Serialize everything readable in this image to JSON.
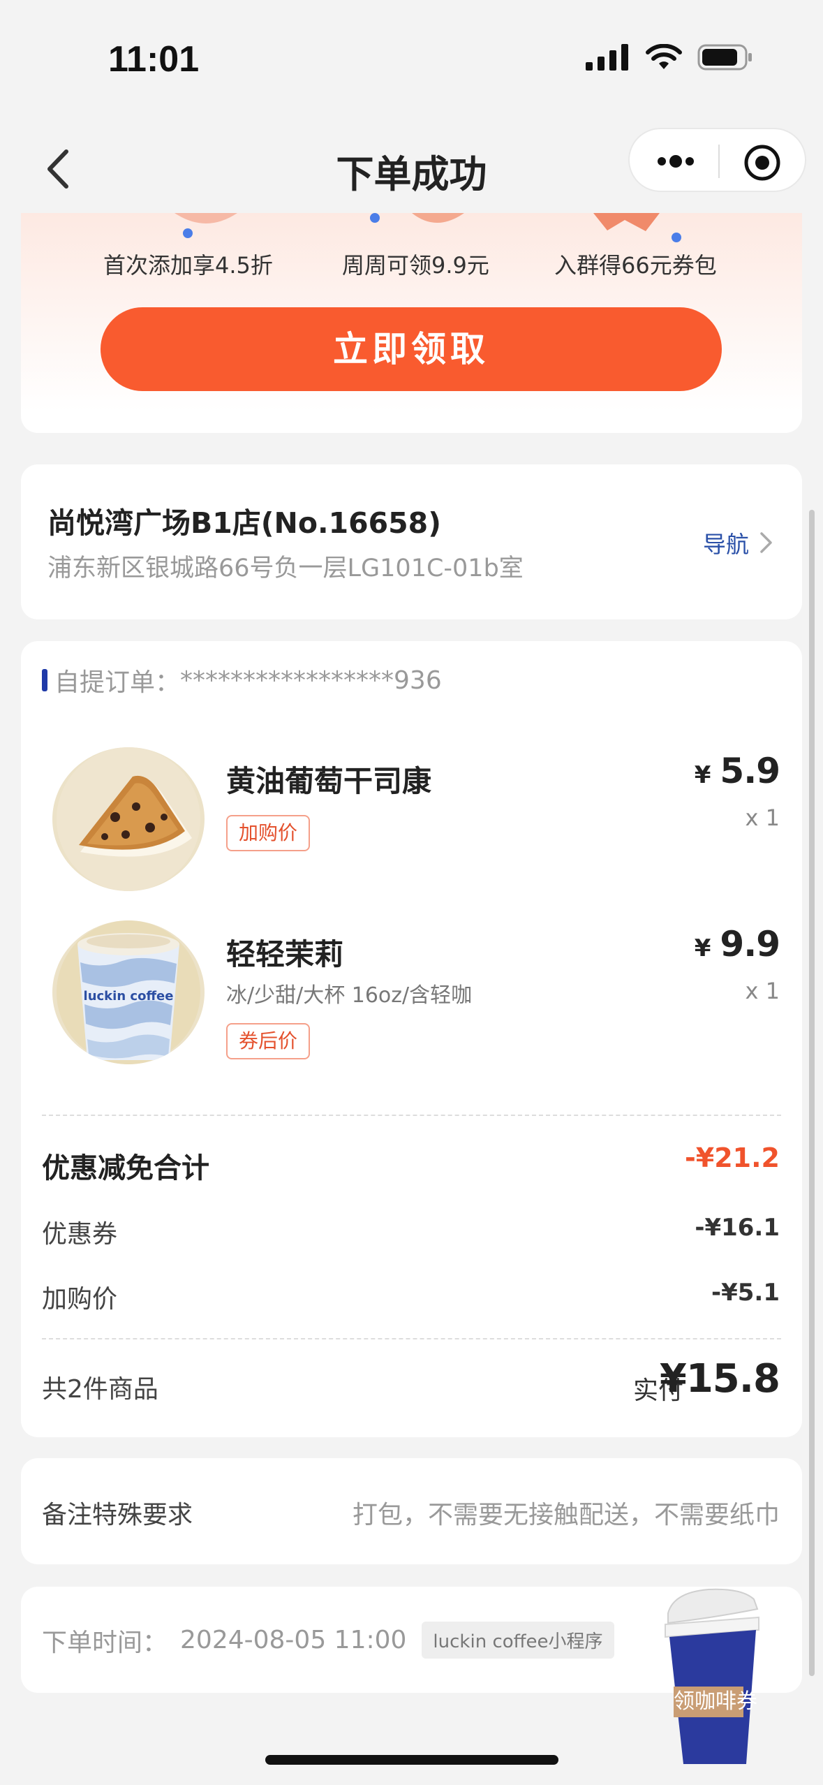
{
  "status_bar": {
    "time": "11:01"
  },
  "nav": {
    "title": "下单成功"
  },
  "promo": {
    "items": [
      "首次添加享4.5折",
      "周周可领9.9元",
      "入群得66元券包"
    ],
    "button_label": "立即领取",
    "accent_color": "#f95b2f"
  },
  "store": {
    "name": "尚悦湾广场B1店(No.16658)",
    "address": "浦东新区银城路66号负一层LG101C-01b室",
    "nav_label": "导航"
  },
  "order": {
    "id_label": "自提订单：",
    "id_value": "*****************936",
    "products": [
      {
        "name": "黄油葡萄干司康",
        "spec": "",
        "tag": "加购价",
        "currency": "¥",
        "price": "5.9",
        "qty": "x 1",
        "thumb_icon": "scone-image"
      },
      {
        "name": "轻轻茉莉",
        "spec": "冰/少甜/大杯 16oz/含轻咖",
        "tag": "券后价",
        "currency": "¥",
        "price": "9.9",
        "qty": "x 1",
        "thumb_icon": "coffee-cup-image"
      }
    ],
    "discount_total_label": "优惠减免合计",
    "discount_total_value": "-¥21.2",
    "discounts": [
      {
        "label": "优惠券",
        "value": "-¥16.1"
      },
      {
        "label": "加购价",
        "value": "-¥5.1"
      }
    ],
    "item_count_label": "共2件商品",
    "paid_label": "实付",
    "paid_value": "¥15.8"
  },
  "note": {
    "label": "备注特殊要求",
    "value": "打包，不需要无接触配送，不需要纸巾"
  },
  "order_time": {
    "label": "下单时间：",
    "value": "2024-08-05 11:00",
    "source": "luckin coffee小程序"
  },
  "float_coupon": {
    "label": "领咖啡券",
    "brand_color": "#2b3a9e"
  }
}
